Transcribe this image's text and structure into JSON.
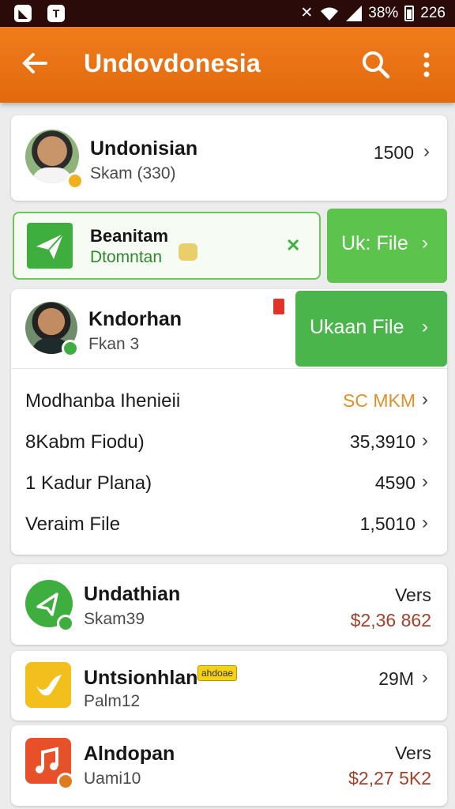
{
  "status_bar": {
    "battery": "38%",
    "time": "226"
  },
  "app_bar": {
    "title": "Undovdonesia"
  },
  "contact_1": {
    "name": "Undonisian",
    "subtitle": "Skam (330)",
    "value": "1500"
  },
  "file_card": {
    "title": "Beanitam",
    "subtitle": "Dtomntan",
    "button_label": "Uk: File"
  },
  "contact_2": {
    "name": "Kndorhan",
    "subtitle": "Fkan 3",
    "button_label": "Ukaan File"
  },
  "list_rows": [
    {
      "label": "Modhanba Ihenieii",
      "value": "SC MKM",
      "value_color": "#e0902a"
    },
    {
      "label": "8Kabm Fiodu)",
      "value": "35,3910",
      "value_color": "#1c1c1c"
    },
    {
      "label": "1 Kadur Plana)",
      "value": "4590",
      "value_color": "#1c1c1c"
    },
    {
      "label": "Veraim File",
      "value": "1,5010",
      "value_color": "#1c1c1c"
    }
  ],
  "apps": [
    {
      "name": "Undathian",
      "subtitle": "Skam39",
      "top_value": "Vers",
      "bottom_value": "$2,36 862",
      "icon": "green-send-icon"
    },
    {
      "name": "Untsionhlan",
      "subtitle": "Palm12",
      "top_value": "29M",
      "tag": "ahdoae",
      "icon": "yellow-bird-icon"
    },
    {
      "name": "Alndopan",
      "subtitle": "Uami10",
      "top_value": "Vers",
      "bottom_value": "$2,27 5K2",
      "icon": "orange-music-icon"
    }
  ],
  "colors": {
    "app_bar": "#ee7618",
    "green": "#5cc34c",
    "price": "#a5402a"
  }
}
